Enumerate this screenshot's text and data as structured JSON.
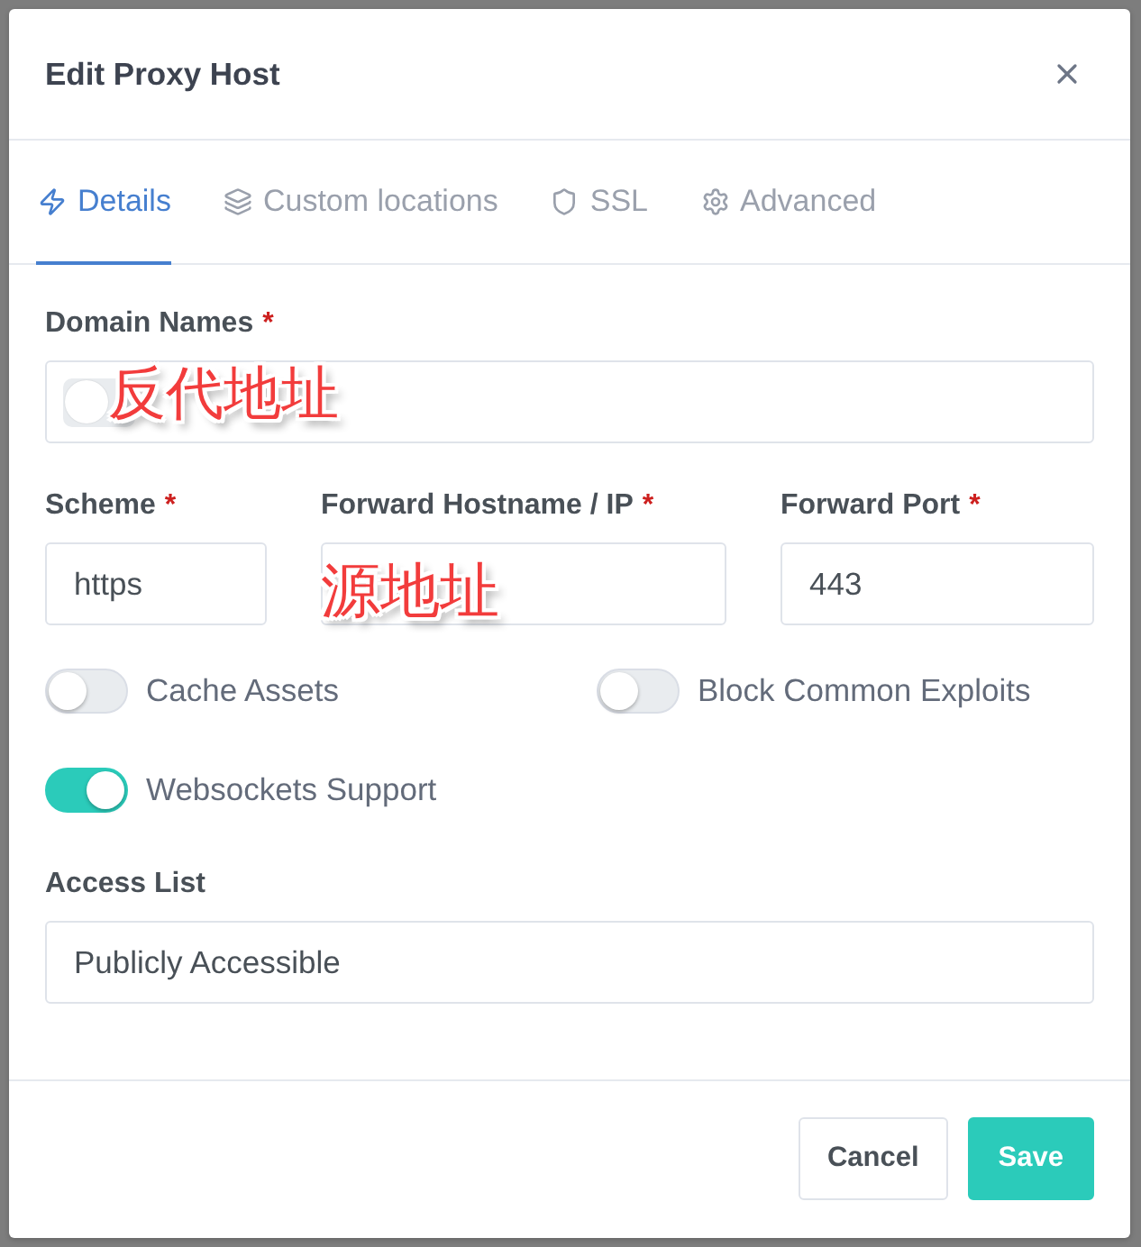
{
  "dialog": {
    "title": "Edit Proxy Host"
  },
  "tabs": [
    {
      "label": "Details",
      "selected": true
    },
    {
      "label": "Custom locations",
      "selected": false
    },
    {
      "label": "SSL",
      "selected": false
    },
    {
      "label": "Advanced",
      "selected": false
    }
  ],
  "domain_names": {
    "label": "Domain Names",
    "required_mark": "*",
    "tags": [
      {
        "kind": "chip"
      }
    ],
    "annotation": "反代地址"
  },
  "forward_fields": [
    {
      "label": "Scheme",
      "required_mark": "*",
      "value": "https"
    },
    {
      "label": "Forward Hostname / IP",
      "required_mark": "*",
      "annotation": "源地址"
    },
    {
      "label": "Forward Port",
      "required_mark": "*",
      "value": "443"
    }
  ],
  "toggles": [
    {
      "label": "Cache Assets",
      "on": false
    },
    {
      "label": "Block Common Exploits",
      "on": false
    },
    {
      "label": "Websockets Support",
      "on": true
    }
  ],
  "access_list": {
    "label": "Access List",
    "value": "Publicly Accessible"
  },
  "buttons": [
    {
      "label": "Cancel",
      "kind": "secondary"
    },
    {
      "label": "Save",
      "kind": "primary"
    }
  ]
}
